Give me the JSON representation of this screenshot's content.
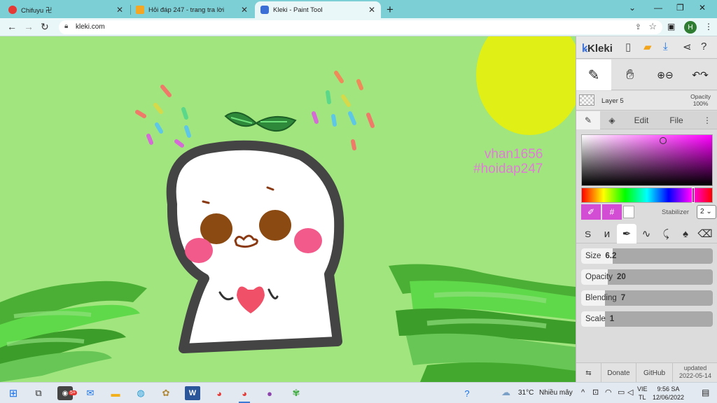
{
  "browser": {
    "tabs": [
      {
        "title": "Chifuyu 卍",
        "active": false
      },
      {
        "title": "Hỏi đáp 247 - trang tra lời",
        "active": false
      },
      {
        "title": "Kleki - Paint Tool",
        "active": true
      }
    ],
    "url": "kleki.com",
    "profile_initial": "H"
  },
  "canvas": {
    "background": "#a0e57d",
    "watermark_line1": "vhan1656",
    "watermark_line2": "#hoidap247"
  },
  "kleki": {
    "logo": "Kleki",
    "layer_name": "Layer 5",
    "layer_opacity_label": "Opacity",
    "layer_opacity_value": "100%",
    "tabs": {
      "edit": "Edit",
      "file": "File"
    },
    "hex_button": "#",
    "stabilizer_label": "Stabilizer",
    "stabilizer_value": "2",
    "current_color": "#ff00ff",
    "sliders": [
      {
        "label": "Size",
        "value": "6.2",
        "fraction": 0.24
      },
      {
        "label": "Opacity",
        "value": "20",
        "fraction": 0.2
      },
      {
        "label": "Blending",
        "value": "7",
        "fraction": 0.07
      },
      {
        "label": "Scale",
        "value": "1",
        "fraction": 0.01
      }
    ],
    "footer": {
      "donate": "Donate",
      "github": "GitHub",
      "updated_label": "updated",
      "updated_date": "2022-05-14"
    }
  },
  "taskbar": {
    "chrome_badge": "5+",
    "weather_temp": "31°C",
    "weather_desc": "Nhiều mây",
    "lang_top": "VIE",
    "lang_bottom": "TL",
    "time": "9:56 SA",
    "date": "12/06/2022"
  }
}
